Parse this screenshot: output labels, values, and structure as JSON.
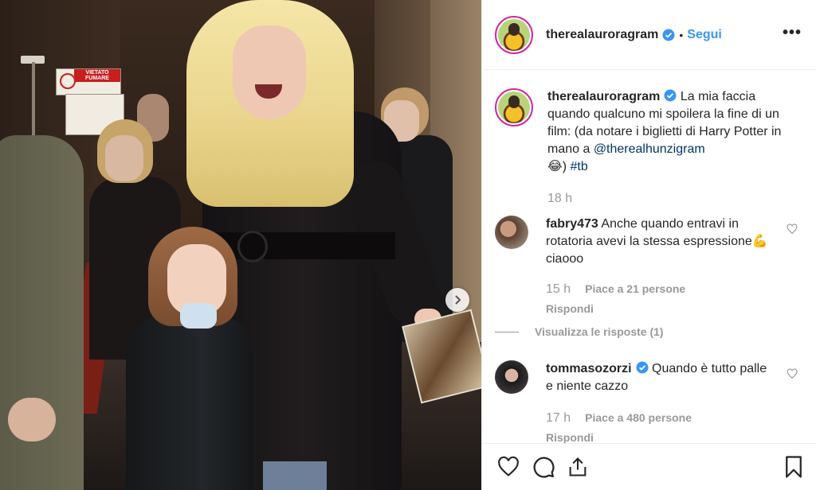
{
  "photo": {
    "sign_text": "VIETATO FUMARE",
    "next_icon": "chevron-right-icon"
  },
  "header": {
    "username": "therealauroragram",
    "separator": "•",
    "follow_label": "Segui",
    "more_label": "•••"
  },
  "caption": {
    "username": "therealauroragram",
    "text_before": " La mia faccia quando qualcuno mi spoilera la fine di un film: (da notare i biglietti di Harry Potter in mano a ",
    "mention": "@therealhunzigram",
    "emoji": "😂",
    "text_after": ") ",
    "hashtag": "#tb",
    "time": "18 h"
  },
  "comments": [
    {
      "username": "fabry473",
      "text_before": " Anche quando entravi in rotatoria avevi la stessa espressione",
      "emoji": "💪",
      "text_after": " ciaooo",
      "time": "15 h",
      "likes": "Piace a 21 persone",
      "reply": "Rispondi",
      "view_replies": "Visualizza le risposte (1)"
    },
    {
      "username": "tommasozorzi",
      "text": " Quando è tutto palle e niente cazzo",
      "time": "17 h",
      "likes": "Piace a 480 persone",
      "reply": "Rispondi"
    }
  ],
  "colors": {
    "link_blue": "#3897f0",
    "verified_blue": "#3897f0",
    "text": "#262626",
    "muted": "#999999"
  }
}
